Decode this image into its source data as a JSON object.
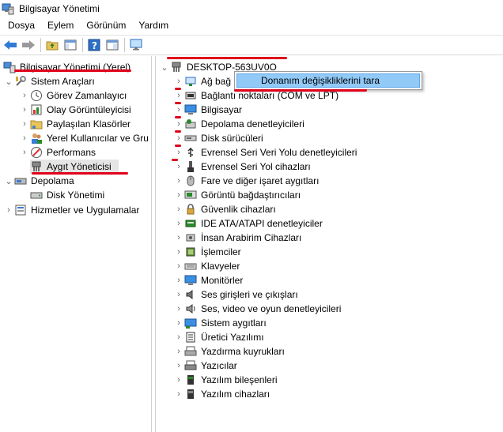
{
  "window": {
    "title": "Bilgisayar Yönetimi"
  },
  "menu": {
    "items": [
      "Dosya",
      "Eylem",
      "Görünüm",
      "Yardım"
    ]
  },
  "left_tree": {
    "root": "Bilgisayar Yönetimi (Yerel)",
    "system_tools": "Sistem Araçları",
    "task_scheduler": "Görev Zamanlayıcı",
    "event_viewer": "Olay Görüntüleyicisi",
    "shared_folders": "Paylaşılan Klasörler",
    "local_users": "Yerel Kullanıcılar ve Gru",
    "performance": "Performans",
    "device_manager": "Aygıt Yöneticisi",
    "storage": "Depolama",
    "disk_management": "Disk Yönetimi",
    "services_apps": "Hizmetler ve Uygulamalar"
  },
  "device_tree": {
    "computer_name": "DESKTOP-563UV0O",
    "categories": [
      "Ağ bağdaştırıcıları",
      "Bağlantı noktaları (COM ve LPT)",
      "Bilgisayar",
      "Depolama denetleyicileri",
      "Disk sürücüleri",
      "Evrensel Seri Veri Yolu denetleyicileri",
      "Evrensel Seri Yol cihazları",
      "Fare ve diğer işaret aygıtları",
      "Görüntü bağdaştırıcıları",
      "Güvenlik cihazları",
      "IDE ATA/ATAPI denetleyiciler",
      "İnsan Arabirim Cihazları",
      "İşlemciler",
      "Klavyeler",
      "Monitörler",
      "Ses girişleri ve çıkışları",
      "Ses, video ve oyun denetleyicileri",
      "Sistem aygıtları",
      "Üretici Yazılımı",
      "Yazdırma kuyrukları",
      "Yazıcılar",
      "Yazılım bileşenleri",
      "Yazılım cihazları"
    ],
    "first_visible_label": "Ağ bağ"
  },
  "context_menu": {
    "scan_label": "Donanım değişikliklerini tara"
  },
  "colors": {
    "annotation_red": "#e0001a",
    "menu_highlight": "#91c9f7",
    "selection": "#e5e5e5"
  }
}
